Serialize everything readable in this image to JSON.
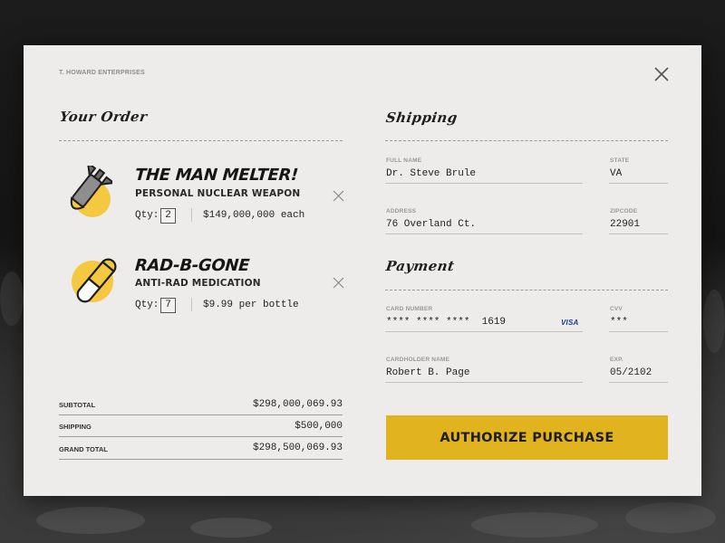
{
  "company": "T. HOWARD ENTERPRISES",
  "order": {
    "title": "Your Order",
    "items": [
      {
        "name": "THE MAN MELTER!",
        "subtitle": "PERSONAL NUCLEAR WEAPON",
        "qty_label": "Qty:",
        "qty": "2",
        "price": "$149,000,000 each",
        "icon": "bomb-icon"
      },
      {
        "name": "RAD-B-GONE",
        "subtitle": "ANTI-RAD MEDICATION",
        "qty_label": "Qty:",
        "qty": "7",
        "price": "$9.99 per bottle",
        "icon": "pill-icon"
      }
    ]
  },
  "totals": {
    "subtotal_label": "SUBTOTAL",
    "subtotal": "$298,000,069.93",
    "shipping_label": "SHIPPING",
    "shipping": "$500,000",
    "grand_total_label": "GRAND TOTAL",
    "grand_total": "$298,500,069.93"
  },
  "shipping": {
    "title": "Shipping",
    "full_name_label": "FULL NAME",
    "full_name": "Dr. Steve Brule",
    "state_label": "STATE",
    "state": "VA",
    "address_label": "ADDRESS",
    "address": "76 Overland Ct.",
    "zipcode_label": "ZIPCODE",
    "zipcode": "22901"
  },
  "payment": {
    "title": "Payment",
    "card_number_label": "CARD NUMBER",
    "card_number": "**** **** ****  1619",
    "card_brand": "VISA",
    "cvv_label": "CVV",
    "cvv": "***",
    "cardholder_label": "CARDHOLDER NAME",
    "cardholder": "Robert B. Page",
    "exp_label": "EXP.",
    "exp": "05/2102"
  },
  "authorize_label": "AUTHORIZE PURCHASE",
  "colors": {
    "accent": "#e1b41f",
    "icon_yellow": "#f5c842",
    "card_bg": "#eeeceb"
  }
}
